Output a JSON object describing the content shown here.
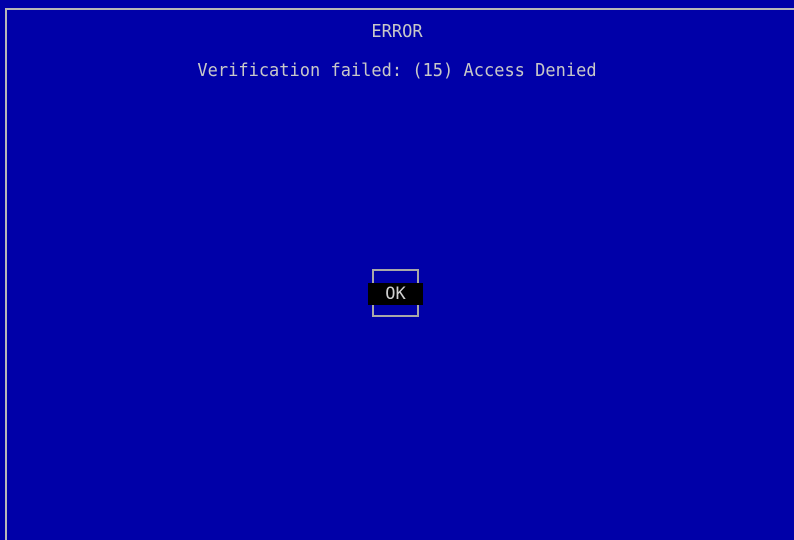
{
  "dialog": {
    "title": "ERROR",
    "message": "Verification failed: (15) Access Denied",
    "ok_label": "OK"
  },
  "colors": {
    "background": "#0000a8",
    "text": "#c8c8c8",
    "button_bg": "#000000",
    "frame": "#b8b8b8"
  }
}
